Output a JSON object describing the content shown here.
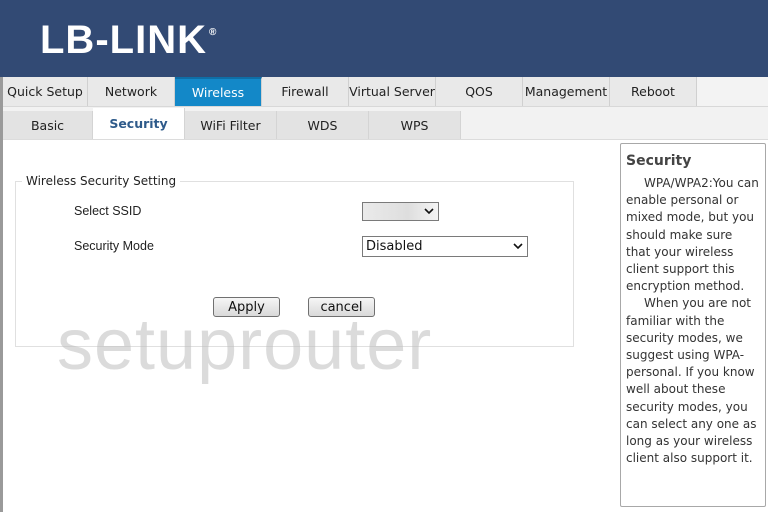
{
  "header": {
    "logo_text": "LB-LINK",
    "logo_reg": "®",
    "background": "#324a74"
  },
  "main_nav": {
    "tabs": [
      {
        "label": "Quick Setup",
        "active": false
      },
      {
        "label": "Network",
        "active": false
      },
      {
        "label": "Wireless",
        "active": true
      },
      {
        "label": "Firewall",
        "active": false
      },
      {
        "label": "Virtual Server",
        "active": false
      },
      {
        "label": "QOS",
        "active": false
      },
      {
        "label": "Management",
        "active": false
      },
      {
        "label": "Reboot",
        "active": false
      }
    ],
    "active_color": "#1388c8"
  },
  "sub_nav": {
    "tabs": [
      {
        "label": "Basic",
        "active": false
      },
      {
        "label": "Security",
        "active": true
      },
      {
        "label": "WiFi Filter",
        "active": false
      },
      {
        "label": "WDS",
        "active": false
      },
      {
        "label": "WPS",
        "active": false
      }
    ]
  },
  "form": {
    "legend": "Wireless Security Setting",
    "select_ssid_label": "Select SSID",
    "select_ssid_value": "",
    "security_mode_label": "Security Mode",
    "security_mode_value": "Disabled",
    "apply_label": "Apply",
    "cancel_label": "cancel"
  },
  "watermark": "setuprouter",
  "help": {
    "title": "Security",
    "paragraphs": [
      "WPA/WPA2:You can enable personal or mixed mode, but you should make sure that your wireless client support this encryption method.",
      "When you are not familiar with the security modes, we suggest using WPA-personal. If you know well about these security modes, you can select any one as long as your wireless client also support it."
    ]
  }
}
